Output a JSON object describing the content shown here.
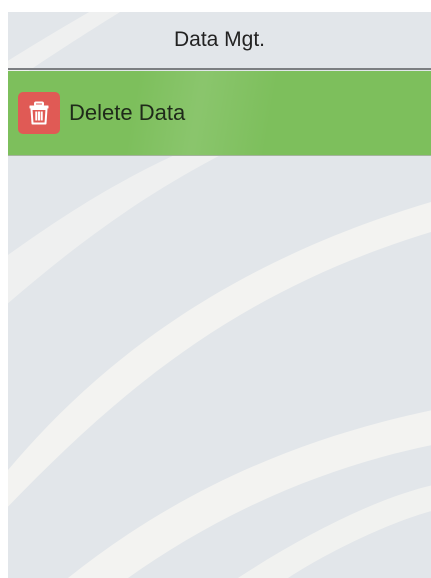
{
  "header": {
    "title": "Data Mgt."
  },
  "menu": {
    "items": [
      {
        "label": "Delete Data",
        "icon": "trash-icon",
        "icon_color": "#e05a55",
        "background": "#7dbf5c"
      }
    ]
  },
  "colors": {
    "screen_background": "#e2e6ea",
    "header_rule": "#7c7f82",
    "selected_row": "#7dbf5c"
  }
}
